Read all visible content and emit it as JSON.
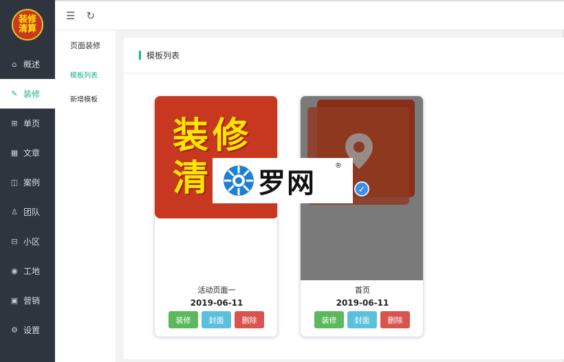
{
  "logo": {
    "line1": "装修",
    "line2": "清算"
  },
  "sidebar": {
    "items": [
      {
        "icon": "home-icon",
        "glyph": "⌂",
        "label": "概述"
      },
      {
        "icon": "pencil-icon",
        "glyph": "✎",
        "label": "装修"
      },
      {
        "icon": "gift-icon",
        "glyph": "⊞",
        "label": "单页"
      },
      {
        "icon": "grid-icon",
        "glyph": "▦",
        "label": "文章"
      },
      {
        "icon": "layout-icon",
        "glyph": "◫",
        "label": "案例"
      },
      {
        "icon": "user-icon",
        "glyph": "♙",
        "label": "团队"
      },
      {
        "icon": "building-icon",
        "glyph": "⊟",
        "label": "小区"
      },
      {
        "icon": "location-icon",
        "glyph": "◉",
        "label": "工地"
      },
      {
        "icon": "marketing-icon",
        "glyph": "▣",
        "label": "营销"
      },
      {
        "icon": "gear-icon",
        "glyph": "⚙",
        "label": "设置"
      }
    ]
  },
  "topbar": {
    "collapse_icon": "menu-collapse-icon",
    "collapse_glyph": "☰",
    "refresh_icon": "refresh-icon",
    "refresh_glyph": "↻"
  },
  "submenu": {
    "title": "页面装修",
    "items": [
      "模板列表",
      "新增模板"
    ]
  },
  "panel": {
    "title": "模板列表"
  },
  "cards": [
    {
      "thumb_text": [
        "装修",
        "清"
      ],
      "name": "活动页面一",
      "date": "2019-06-11",
      "buttons": [
        "装修",
        "封面",
        "删除"
      ]
    },
    {
      "check_glyph": "✓",
      "name": "首页",
      "date": "2019-06-11",
      "buttons": [
        "装修",
        "封面",
        "删除"
      ]
    }
  ],
  "watermark": {
    "text": "罗网",
    "reg": "®"
  },
  "colors": {
    "accent": "#19b38b",
    "sidebar": "#2f353f",
    "green": "#5cb85c",
    "blue": "#5bc0de",
    "red": "#d9534f"
  }
}
